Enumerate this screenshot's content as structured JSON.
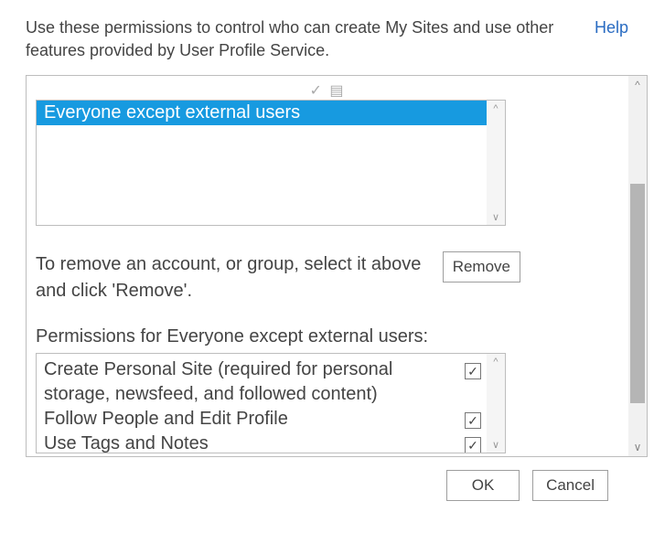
{
  "intro": "Use these permissions to control who can create My Sites and use other features provided by User Profile Service.",
  "help_label": "Help",
  "accounts": {
    "items": [
      {
        "label": "Everyone except external users",
        "selected": true
      }
    ]
  },
  "remove": {
    "text": "To remove an account, or group, select it above and click 'Remove'.",
    "button": "Remove"
  },
  "permissions": {
    "heading": "Permissions for Everyone except external users:",
    "items": [
      {
        "label": "Create Personal Site (required for personal storage, newsfeed, and followed content)",
        "checked": true
      },
      {
        "label": "Follow People and Edit Profile",
        "checked": true
      },
      {
        "label": "Use Tags and Notes",
        "checked": true
      }
    ]
  },
  "buttons": {
    "ok": "OK",
    "cancel": "Cancel"
  }
}
